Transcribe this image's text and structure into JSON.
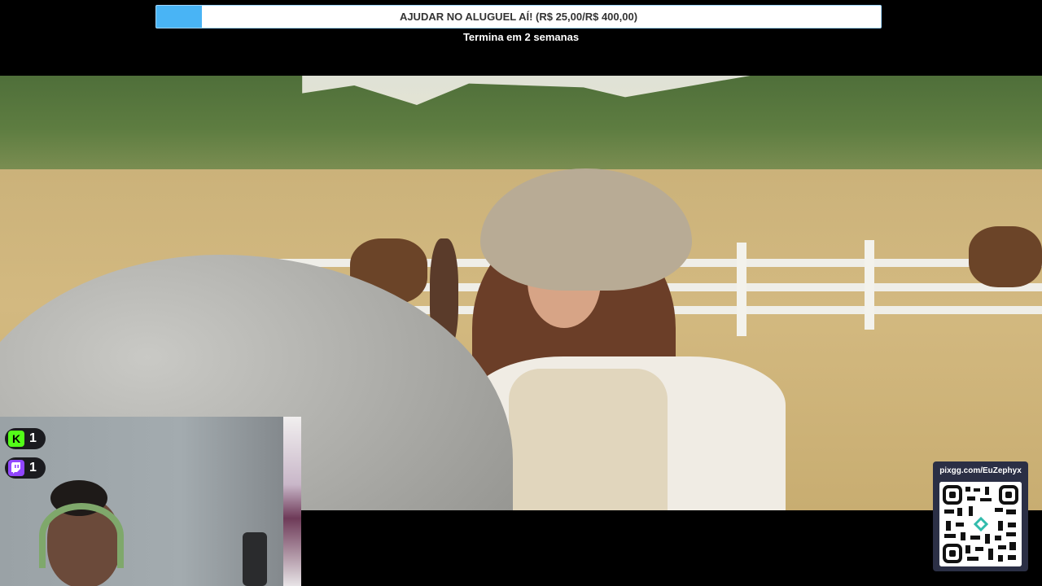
{
  "goal": {
    "title": "AJUDAR NO ALUGUEL AÍ! (R$ 25,00/R$ 400,00)",
    "current": 25,
    "target": 400,
    "progress_fraction": 0.0625,
    "subtitle": "Termina em 2 semanas",
    "fill_color": "#49b4f5"
  },
  "viewers": [
    {
      "platform_icon": "kick-icon",
      "count": "1",
      "color": "#53fc18"
    },
    {
      "platform_icon": "twitch-icon",
      "count": "1",
      "color": "#9146ff"
    }
  ],
  "pix": {
    "url_label": "pixgg.com/EuZephyx",
    "qr_icon": "qr-code-icon"
  }
}
